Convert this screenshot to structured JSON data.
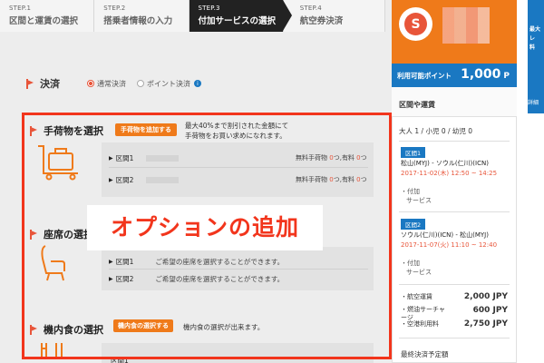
{
  "steps": [
    {
      "num": "STEP.1",
      "name": "区間と運賃の選択"
    },
    {
      "num": "STEP.2",
      "name": "搭乗者情報の入力"
    },
    {
      "num": "STEP.3",
      "name": "付加サービスの選択"
    },
    {
      "num": "STEP.4",
      "name": "航空券決済"
    }
  ],
  "payment": {
    "title": "決済",
    "opt1": "通常決済",
    "opt2": "ポイント決済",
    "info": "i"
  },
  "baggage": {
    "title": "手荷物を選択",
    "button": "手荷物を追加する",
    "desc": "最大40%まで割引された金額にて手荷物をお買い求めになれます。",
    "seg1": "区間1",
    "seg2": "区間2",
    "free_label": "無料手荷物",
    "free_val": "0",
    "unit": "つ,",
    "paid_label": "有料",
    "paid_val": "0",
    "unit2": "つ"
  },
  "seat": {
    "title": "座席の選択",
    "seg1": "区間1",
    "seg2": "区間2",
    "desc1": "ご希望の座席を選択することができます。",
    "desc2": "ご希望の座席を選択することができます。"
  },
  "meal": {
    "title": "機内食の選択",
    "button": "機内食の選択する",
    "desc": "機内食の選択が出来ます。",
    "seg1": "区間1"
  },
  "overlay": "オプションの追加",
  "sidebar": {
    "logo_letter": "S",
    "points_label": "利用可能ポイント",
    "points_value": "1,000",
    "points_unit": "P",
    "section_title": "区間や運賃",
    "pax": "大人 1 / 小児 0 / 幼児 0",
    "seg1": {
      "tag": "区間1",
      "route": "松山(MYJ) - ソウル(仁川)(ICN)",
      "date": "2017-11-02(木) 12:50 ~ 14:25",
      "extra1": "・付加",
      "extra2": "サービス"
    },
    "seg2": {
      "tag": "区間2",
      "route": "ソウル(仁川)(ICN) - 松山(MYJ)",
      "date": "2017-11-07(火) 11:10 ~ 12:40",
      "extra1": "・付加",
      "extra2": "サービス"
    },
    "fares": [
      {
        "label": "・航空運賃",
        "value": "2,000 JPY"
      },
      {
        "label": "・燃油サーチャージ",
        "value": "600 JPY"
      },
      {
        "label": "・空港利用料",
        "value": "2,750 JPY"
      }
    ],
    "total_label": "最終決済予定額"
  },
  "ad": {
    "line1": "最大",
    "line2": "レ",
    "line3": "料",
    "sub": "詳細"
  },
  "colors": {
    "accent": "#ef7a1a",
    "blue": "#1a78c2",
    "highlight": "#f2351c",
    "red": "#e8553a"
  }
}
